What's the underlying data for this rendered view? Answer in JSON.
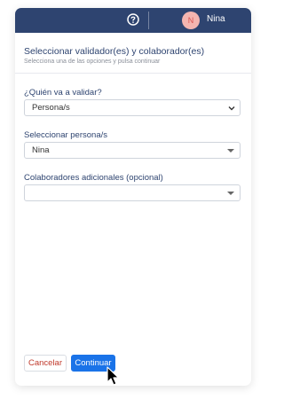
{
  "header_bar": {
    "help_icon": "question-circle-icon",
    "avatar_initial": "N",
    "user_name": "Nina",
    "bar_color": "#2e4470",
    "avatar_color": "#f4b5b0"
  },
  "dialog": {
    "title": "Seleccionar validador(es) y colaborador(es)",
    "subtitle": "Selecciona una de las opciones y pulsa continuar"
  },
  "fields": {
    "validator_type": {
      "label": "¿Quién va a validar?",
      "value": "Persona/s"
    },
    "persons": {
      "label": "Seleccionar persona/s",
      "value": "Nina"
    },
    "collaborators": {
      "label": "Colaboradores adicionales (opcional)",
      "value": ""
    }
  },
  "actions": {
    "cancel_label": "Cancelar",
    "continue_label": "Continuar",
    "cancel_color": "#c0392b",
    "continue_color": "#1a73e8"
  }
}
